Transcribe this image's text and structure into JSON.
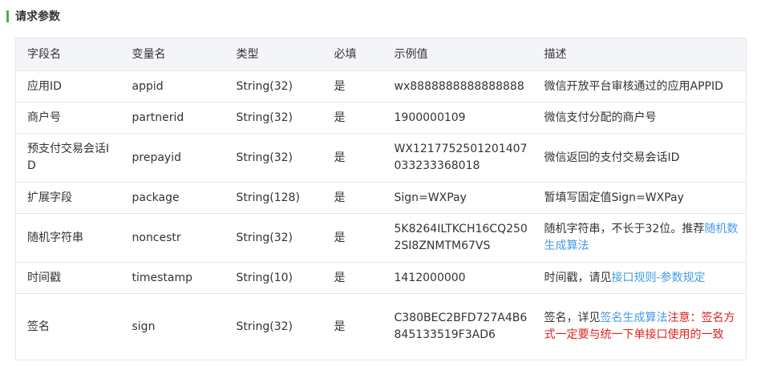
{
  "section": {
    "title": "请求参数"
  },
  "table": {
    "headers": [
      "字段名",
      "变量名",
      "类型",
      "必填",
      "示例值",
      "描述"
    ],
    "rows": [
      {
        "field": "应用ID",
        "var": "appid",
        "type": "String(32)",
        "required": "是",
        "example": "wx8888888888888888",
        "desc": "微信开放平台审核通过的应用APPID"
      },
      {
        "field": "商户号",
        "var": "partnerid",
        "type": "String(32)",
        "required": "是",
        "example": "1900000109",
        "desc": "微信支付分配的商户号"
      },
      {
        "field": "预支付交易会话ID",
        "var": "prepayid",
        "type": "String(32)",
        "required": "是",
        "example": "WX1217752501201407033233368018",
        "desc": "微信返回的支付交易会话ID"
      },
      {
        "field": "扩展字段",
        "var": "package",
        "type": "String(128)",
        "required": "是",
        "example": "Sign=WXPay",
        "desc": "暂填写固定值Sign=WXPay"
      },
      {
        "field": "随机字符串",
        "var": "noncestr",
        "type": "String(32)",
        "required": "是",
        "example": "5K8264ILTKCH16CQ2502SI8ZNMTM67VS",
        "desc_text": "随机字符串，不长于32位。推荐",
        "desc_link": "随机数生成算法"
      },
      {
        "field": "时间戳",
        "var": "timestamp",
        "type": "String(10)",
        "required": "是",
        "example": "1412000000",
        "desc_text": "时间戳，请见",
        "desc_link": "接口规则-参数规定"
      },
      {
        "field": "签名",
        "var": "sign",
        "type": "String(32)",
        "required": "是",
        "example": "C380BEC2BFD727A4B6845133519F3AD6",
        "desc_text": "签名，详见",
        "desc_link": "签名生成算法",
        "desc_warn": "注意：签名方式一定要与统一下单接口使用的一致"
      }
    ]
  },
  "colors": {
    "accent_bar": "#44b549",
    "header_bg": "#f4f5f9",
    "border": "#e7e7eb",
    "link": "#459ae9",
    "warning": "#e02020"
  }
}
